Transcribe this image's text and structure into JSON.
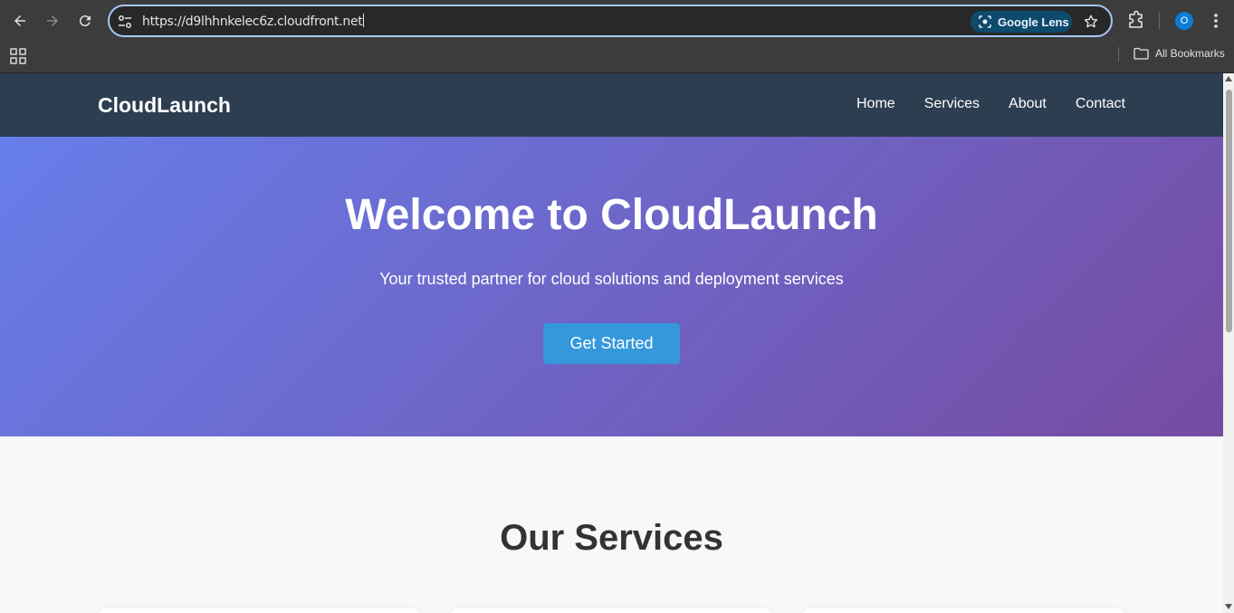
{
  "browser": {
    "url": "https://d9lhhnkelec6z.cloudfront.net",
    "lens_label": "Google Lens",
    "profile_initial": "O",
    "all_bookmarks_label": "All Bookmarks"
  },
  "site": {
    "brand": "CloudLaunch",
    "nav": [
      "Home",
      "Services",
      "About",
      "Contact"
    ]
  },
  "hero": {
    "title": "Welcome to CloudLaunch",
    "subtitle": "Your trusted partner for cloud solutions and deployment services",
    "cta_label": "Get Started",
    "gradient_start": "#667eea",
    "gradient_end": "#764ba2"
  },
  "services": {
    "heading": "Our Services"
  },
  "colors": {
    "header_bg": "#2c3e50",
    "cta_bg": "#3498db",
    "heading_text": "#333333"
  }
}
